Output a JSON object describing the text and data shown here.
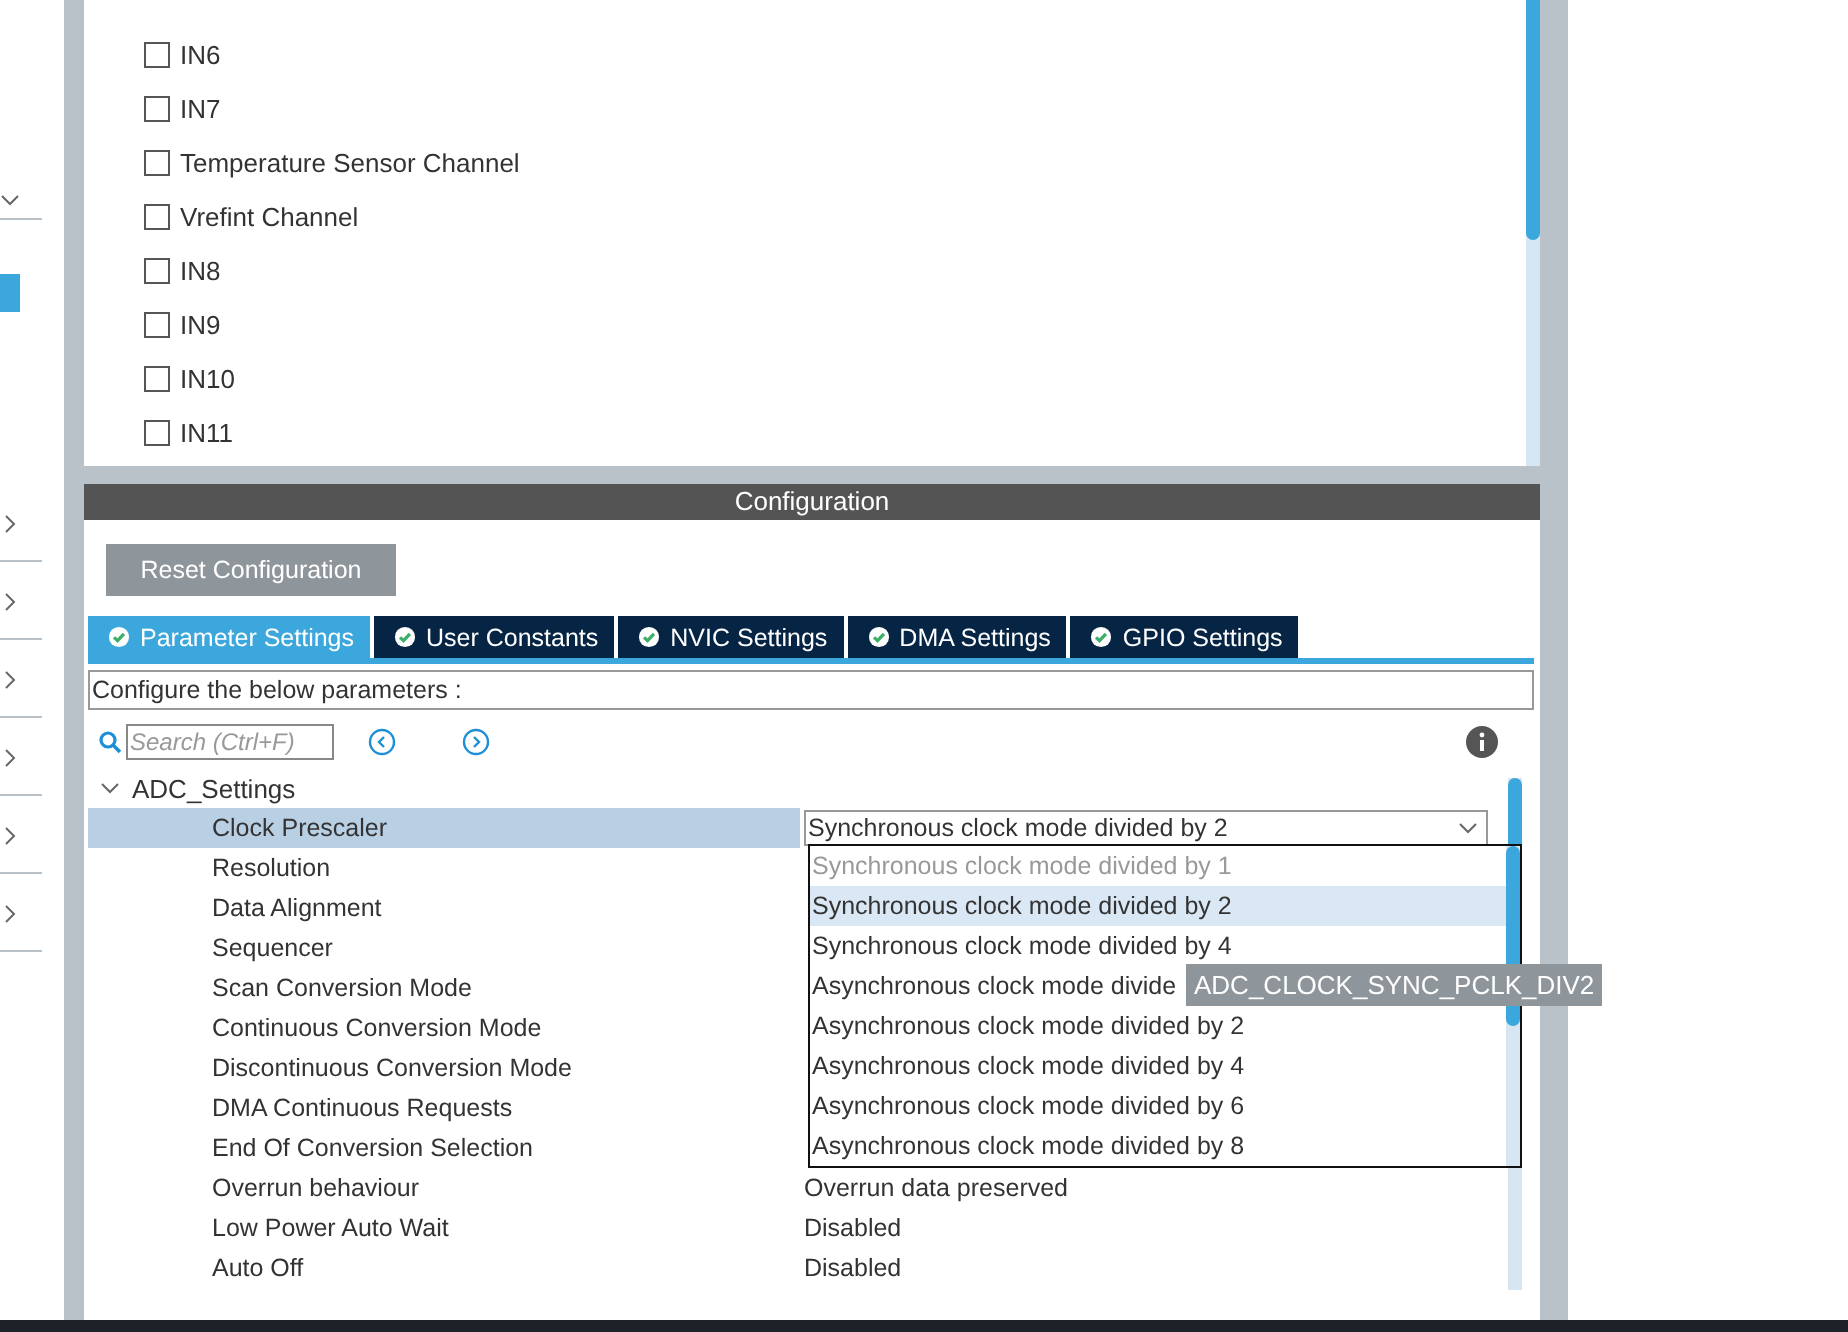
{
  "channels": [
    {
      "label": "IN6",
      "checked": false
    },
    {
      "label": "IN7",
      "checked": false
    },
    {
      "label": "Temperature Sensor Channel",
      "checked": false
    },
    {
      "label": "Vrefint Channel",
      "checked": false
    },
    {
      "label": "IN8",
      "checked": false
    },
    {
      "label": "IN9",
      "checked": false
    },
    {
      "label": "IN10",
      "checked": false
    },
    {
      "label": "IN11",
      "checked": false
    }
  ],
  "configuration": {
    "title": "Configuration",
    "reset_button": "Reset Configuration",
    "tabs": [
      {
        "label": "Parameter Settings",
        "selected": true
      },
      {
        "label": "User Constants",
        "selected": false
      },
      {
        "label": "NVIC Settings",
        "selected": false
      },
      {
        "label": "DMA Settings",
        "selected": false
      },
      {
        "label": "GPIO Settings",
        "selected": false
      }
    ],
    "hint": "Configure the below parameters :",
    "search": {
      "placeholder": "Search (Ctrl+F)"
    },
    "group": {
      "label": "ADC_Settings",
      "expanded": true
    },
    "params": [
      {
        "label": "Clock Prescaler",
        "selected": true,
        "value": "Synchronous clock mode divided by 2"
      },
      {
        "label": "Resolution",
        "selected": false
      },
      {
        "label": "Data Alignment",
        "selected": false
      },
      {
        "label": "Sequencer",
        "selected": false
      },
      {
        "label": "Scan Conversion Mode",
        "selected": false
      },
      {
        "label": "Continuous Conversion Mode",
        "selected": false
      },
      {
        "label": "Discontinuous Conversion Mode",
        "selected": false
      },
      {
        "label": "DMA Continuous Requests",
        "selected": false
      },
      {
        "label": "End Of Conversion Selection",
        "selected": false
      },
      {
        "label": "Overrun behaviour",
        "selected": false,
        "value": "Overrun data preserved"
      },
      {
        "label": "Low Power Auto Wait",
        "selected": false,
        "value": "Disabled"
      },
      {
        "label": "Auto Off",
        "selected": false,
        "value": "Disabled"
      }
    ],
    "dropdown_options": [
      {
        "label": "Synchronous clock mode divided by 1",
        "selected": false,
        "disabled": true
      },
      {
        "label": "Synchronous clock mode divided by 2",
        "selected": true,
        "disabled": false
      },
      {
        "label": "Synchronous clock mode divided by 4",
        "selected": false,
        "disabled": false
      },
      {
        "label": "Asynchronous clock mode divide",
        "selected": false,
        "disabled": false
      },
      {
        "label": "Asynchronous clock mode divided by 2",
        "selected": false,
        "disabled": false
      },
      {
        "label": "Asynchronous clock mode divided by 4",
        "selected": false,
        "disabled": false
      },
      {
        "label": "Asynchronous clock mode divided by 6",
        "selected": false,
        "disabled": false
      },
      {
        "label": "Asynchronous clock mode divided by 8",
        "selected": false,
        "disabled": false
      }
    ],
    "tooltip": "ADC_CLOCK_SYNC_PCLK_DIV2"
  }
}
